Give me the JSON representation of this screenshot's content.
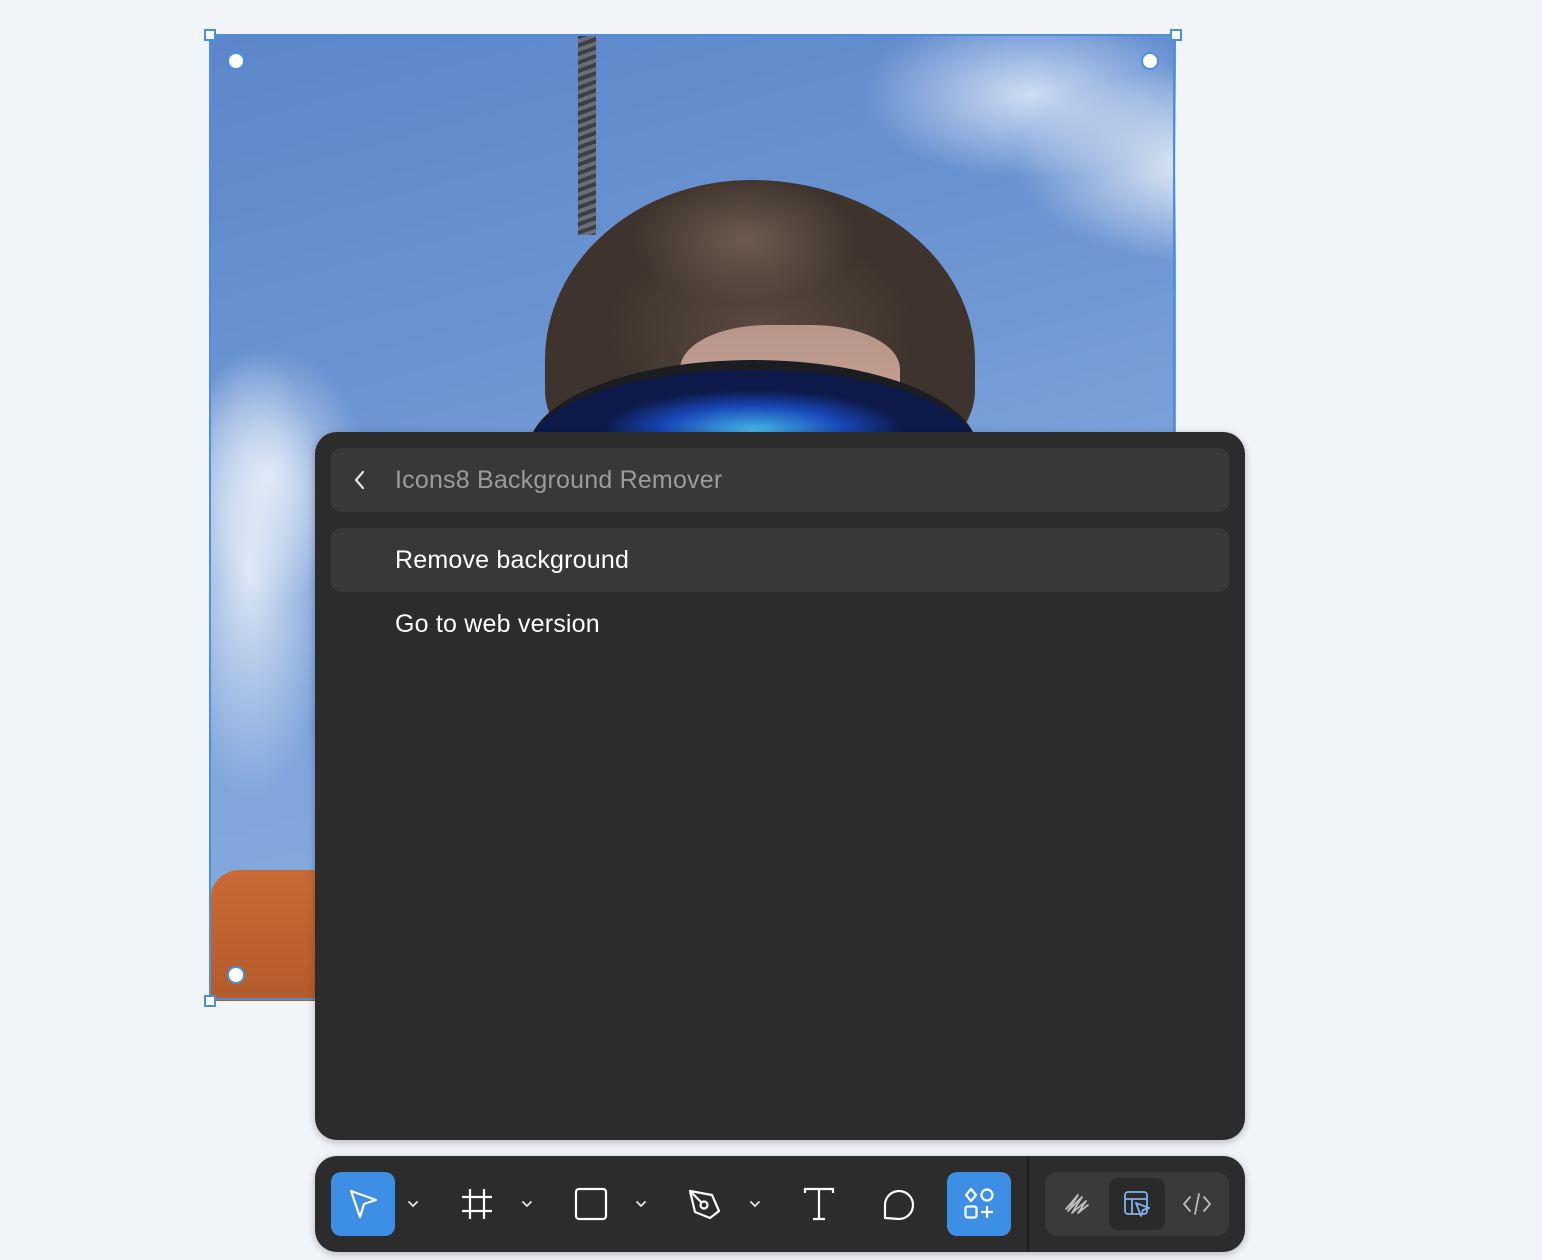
{
  "plugin_panel": {
    "title": "Icons8 Background Remover",
    "menu_items": [
      {
        "label": "Remove background",
        "highlighted": true
      },
      {
        "label": "Go to web version",
        "highlighted": false
      }
    ]
  },
  "toolbar": {
    "tools": [
      {
        "name": "move",
        "icon": "cursor-arrow-icon",
        "active": true,
        "has_menu": true
      },
      {
        "name": "frame",
        "icon": "frame-hash-icon",
        "active": false,
        "has_menu": true
      },
      {
        "name": "rectangle",
        "icon": "rectangle-icon",
        "active": false,
        "has_menu": true
      },
      {
        "name": "pen",
        "icon": "pen-nib-icon",
        "active": false,
        "has_menu": true
      },
      {
        "name": "text",
        "icon": "text-T-icon",
        "active": false,
        "has_menu": false
      },
      {
        "name": "comment",
        "icon": "comment-bubble-icon",
        "active": false,
        "has_menu": false
      },
      {
        "name": "actions",
        "icon": "shapes-plus-icon",
        "active": true,
        "has_menu": false
      }
    ],
    "modes": [
      {
        "name": "draw",
        "icon": "scribble-icon",
        "active": false
      },
      {
        "name": "design",
        "icon": "design-mode-icon",
        "active": true
      },
      {
        "name": "dev",
        "icon": "code-brackets-icon",
        "active": false
      }
    ]
  },
  "colors": {
    "canvas_bg": "#f1f4f8",
    "selection_blue": "#4a90e2",
    "panel_bg": "#2c2c2c",
    "panel_header_bg": "#383838",
    "accent": "#3d8ee5",
    "title_text": "#9b9b9b",
    "item_text": "#ffffff"
  }
}
